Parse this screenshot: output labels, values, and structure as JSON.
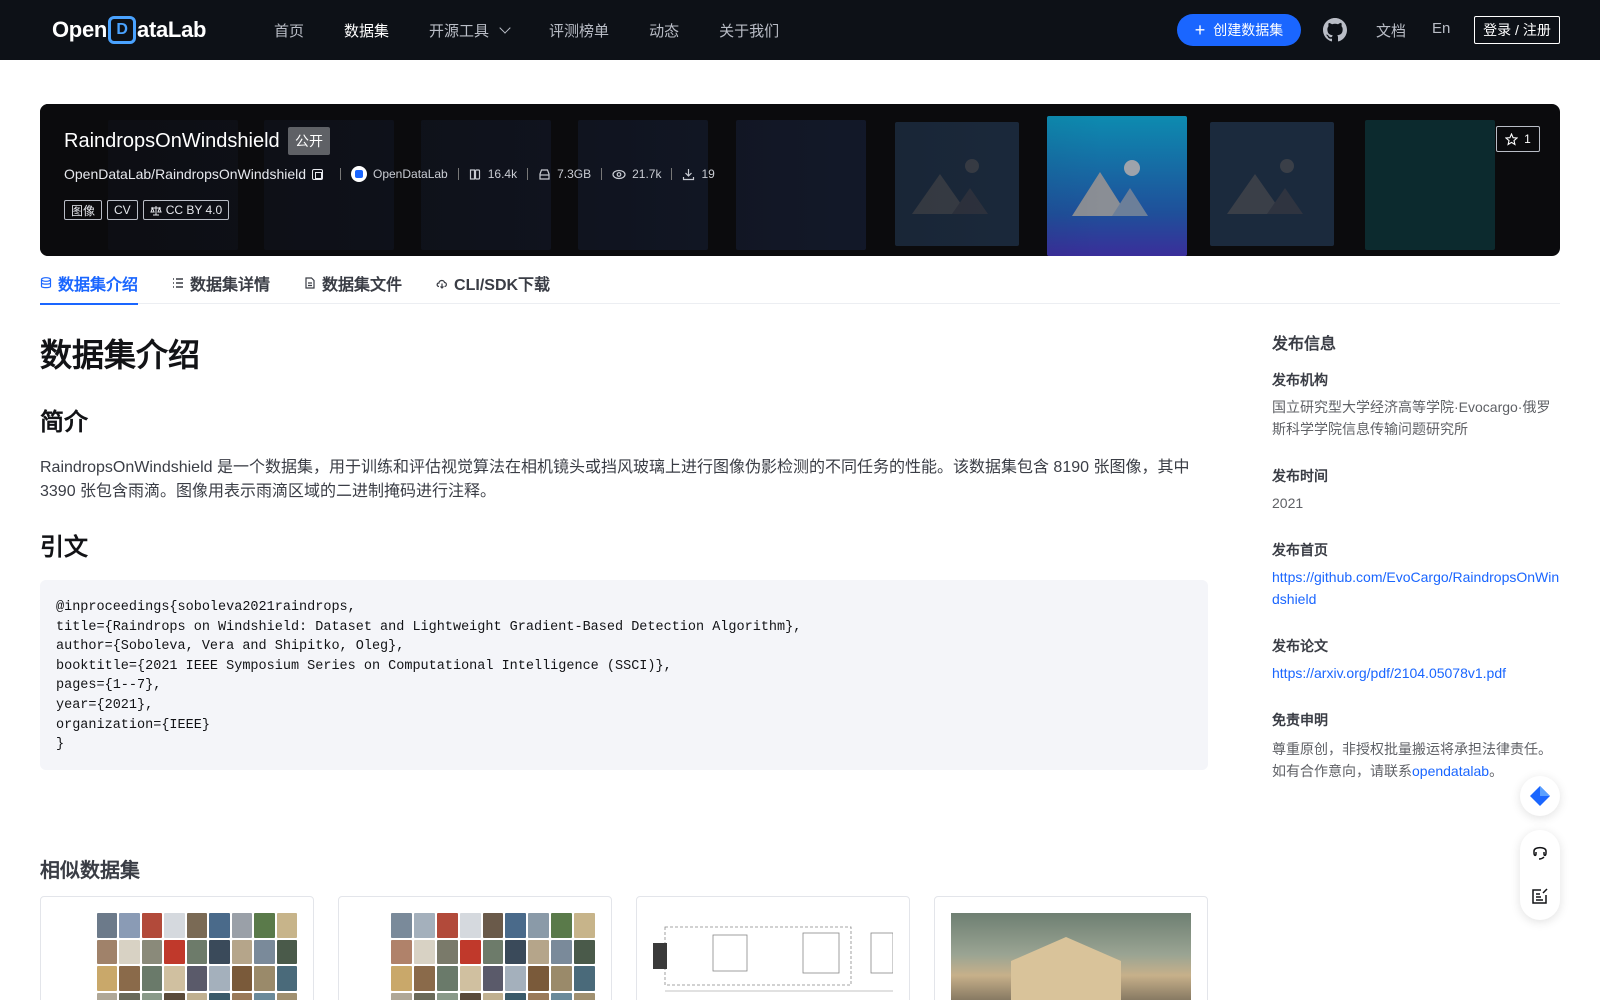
{
  "nav": {
    "logo_left": "Open",
    "logo_mark": "D",
    "logo_right": "ataLab",
    "links": [
      "首页",
      "数据集",
      "开源工具",
      "评测榜单",
      "动态",
      "关于我们"
    ],
    "active_link": "数据集",
    "create_button": "创建数据集",
    "docs": "文档",
    "lang": "En",
    "login": "登录 / 注册"
  },
  "banner": {
    "title": "RaindropsOnWindshield",
    "visibility": "公开",
    "path": "OpenDataLab/RaindropsOnWindshield",
    "org": "OpenDataLab",
    "stats": {
      "likes_view": "16.4k",
      "size": "7.3GB",
      "views": "21.7k",
      "downloads": "19"
    },
    "tags": [
      "图像",
      "CV",
      "CC BY 4.0"
    ],
    "stars": "1"
  },
  "tabs": [
    "数据集介绍",
    "数据集详情",
    "数据集文件",
    "CLI/SDK下载"
  ],
  "main": {
    "heading": "数据集介绍",
    "intro_heading": "简介",
    "intro_text": "RaindropsOnWindshield 是一个数据集，用于训练和评估视觉算法在相机镜头或挡风玻璃上进行图像伪影检测的不同任务的性能。该数据集包含 8190 张图像，其中 3390 张包含雨滴。图像用表示雨滴区域的二进制掩码进行注释。",
    "citation_heading": "引文",
    "citation": "@inproceedings{soboleva2021raindrops,\ntitle={Raindrops on Windshield: Dataset and Lightweight Gradient-Based Detection Algorithm},\nauthor={Soboleva, Vera and Shipitko, Oleg},\nbooktitle={2021 IEEE Symposium Series on Computational Intelligence (SSCI)},\npages={1--7},\nyear={2021},\norganization={IEEE}\n}",
    "similar_heading": "相似数据集"
  },
  "sidebar": {
    "title": "发布信息",
    "org_label": "发布机构",
    "org_value": "国立研究型大学经济高等学院·Evocargo·俄罗斯科学学院信息传输问题研究所",
    "time_label": "发布时间",
    "time_value": "2021",
    "home_label": "发布首页",
    "home_value": "https://github.com/EvoCargo/RaindropsOnWindshield",
    "paper_label": "发布论文",
    "paper_value": "https://arxiv.org/pdf/2104.05078v1.pdf",
    "disclaimer_label": "免责申明",
    "disclaimer_text": "尊重原创，非授权批量搬运将承担法律责任。如有合作意向，请联系",
    "disclaimer_link": "opendatalab",
    "disclaimer_end": "。"
  },
  "colors": {
    "accent": "#1a66ff",
    "nav_bg": "#0d1117",
    "code_bg": "#f4f5f9"
  },
  "icons": [
    "plus-icon",
    "github-icon",
    "copy-icon",
    "org-logo-icon",
    "like-icon",
    "disk-icon",
    "eye-icon",
    "download-icon",
    "license-icon",
    "star-icon",
    "database-icon",
    "list-icon",
    "file-icon",
    "cloud-icon",
    "diamond-icon",
    "headset-icon",
    "feedback-icon"
  ]
}
